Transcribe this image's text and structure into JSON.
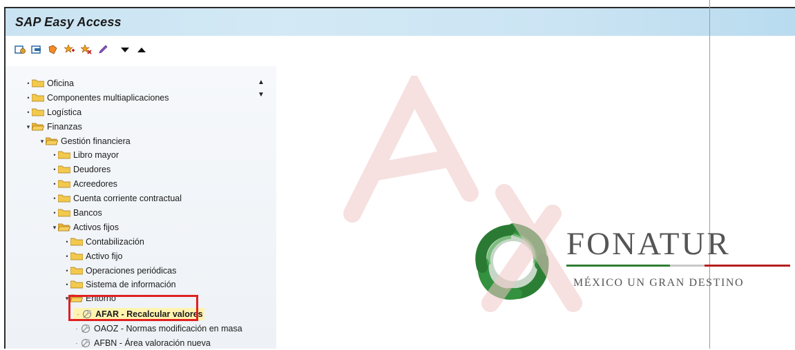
{
  "window": {
    "title": "SAP Easy Access"
  },
  "toolbar": {
    "icons": [
      "user-menu-icon",
      "sap-menu-icon",
      "other-menu-icon",
      "add-favorite-icon",
      "delete-favorite-icon",
      "edit-pencil-icon",
      "expand-down-icon",
      "collapse-up-icon"
    ]
  },
  "tree": {
    "items": [
      {
        "label": "Oficina"
      },
      {
        "label": "Componentes multiaplicaciones"
      },
      {
        "label": "Logística"
      },
      {
        "label": "Finanzas"
      },
      {
        "label": "Gestión financiera"
      },
      {
        "label": "Libro mayor"
      },
      {
        "label": "Deudores"
      },
      {
        "label": "Acreedores"
      },
      {
        "label": "Cuenta corriente contractual"
      },
      {
        "label": "Bancos"
      },
      {
        "label": "Activos fijos"
      },
      {
        "label": "Contabilización"
      },
      {
        "label": "Activo fijo"
      },
      {
        "label": "Operaciones periódicas"
      },
      {
        "label": "Sistema de información"
      },
      {
        "label": "Entorno"
      },
      {
        "label": "AFAR - Recalcular valores"
      },
      {
        "label": "OAOZ - Normas modificación en masa"
      },
      {
        "label": "AFBN - Área valoración nueva"
      }
    ]
  },
  "brand": {
    "name": "FONATUR",
    "tagline": "MÉXICO UN GRAN DESTINO",
    "colors": {
      "green": "#2e7d32",
      "red": "#b71c1c"
    }
  },
  "colors": {
    "highlight": "#e02020",
    "folder": "#f2c94c",
    "titlebar": "#cfe6f4"
  }
}
